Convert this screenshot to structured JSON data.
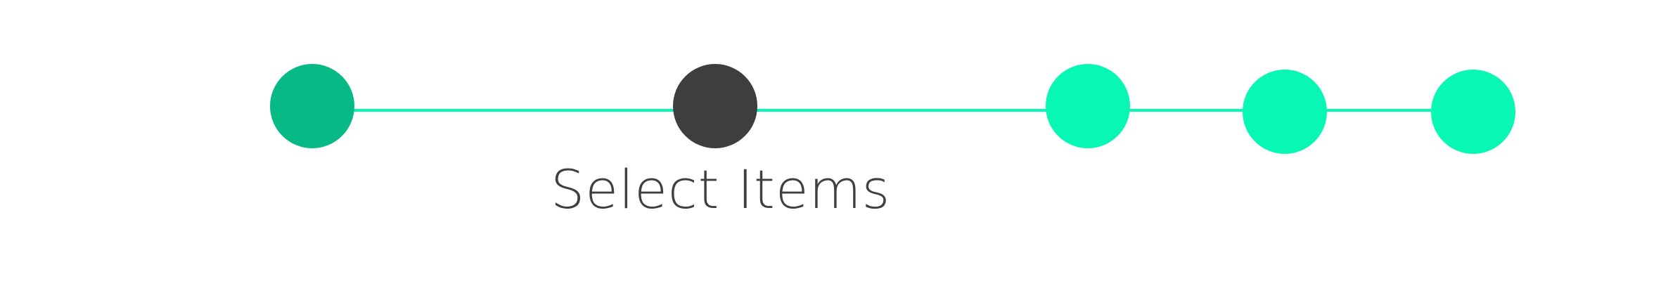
{
  "stepper": {
    "steps": [
      {
        "state": "completed",
        "color": "#07b985"
      },
      {
        "state": "current",
        "color": "#3e3e3e",
        "label": "Select Items"
      },
      {
        "state": "upcoming",
        "color": "#08f7b4"
      },
      {
        "state": "upcoming",
        "color": "#08f7b4"
      },
      {
        "state": "upcoming",
        "color": "#08f7b4"
      }
    ],
    "track_color": "#08f7b4"
  }
}
